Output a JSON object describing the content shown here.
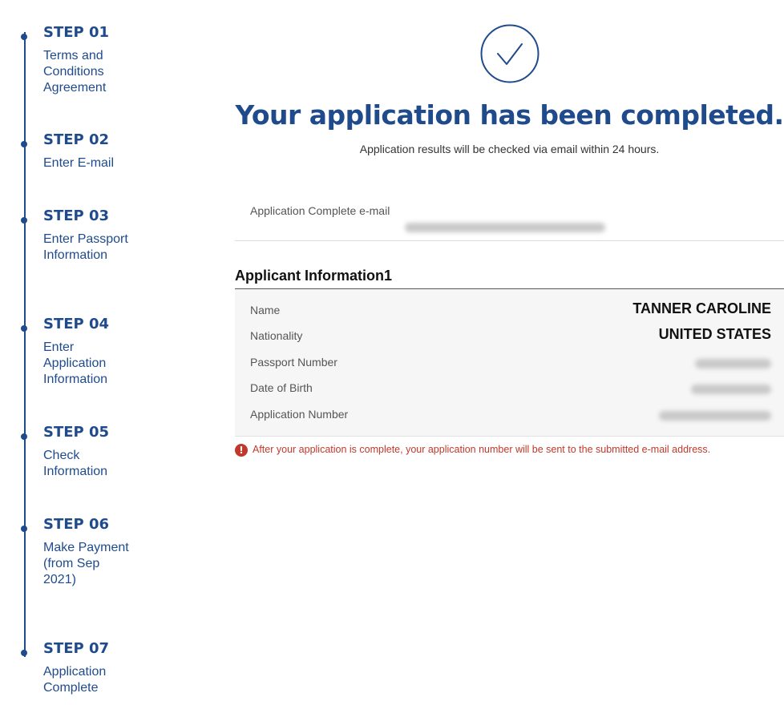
{
  "steps": [
    {
      "title": "STEP 01",
      "desc": "Terms and Conditions Agreement"
    },
    {
      "title": "STEP 02",
      "desc": "Enter E-mail"
    },
    {
      "title": "STEP 03",
      "desc": "Enter Passport Information"
    },
    {
      "title": "STEP 04",
      "desc": "Enter Application Information"
    },
    {
      "title": "STEP 05",
      "desc": "Check Information"
    },
    {
      "title": "STEP 06",
      "desc": "Make Payment (from Sep 2021)"
    },
    {
      "title": "STEP 07",
      "desc": "Application Complete"
    }
  ],
  "completion": {
    "icon": "check-circle-icon",
    "headline": "Your application has been completed.",
    "subtext": "Application results will be checked via email within 24 hours."
  },
  "email": {
    "label": "Application Complete e-mail"
  },
  "applicant": {
    "section_title": "Applicant Information1",
    "name_label": "Name",
    "name_value": "TANNER CAROLINE",
    "nationality_label": "Nationality",
    "nationality_value": "UNITED STATES",
    "passport_label": "Passport Number",
    "dob_label": "Date of Birth",
    "appnum_label": "Application Number"
  },
  "notice": {
    "icon": "alert-icon",
    "text": "After your application is complete, your application number will be sent to the submitted e-mail address."
  },
  "colors": {
    "primary": "#1f4b8c",
    "alert": "#c0392b"
  }
}
